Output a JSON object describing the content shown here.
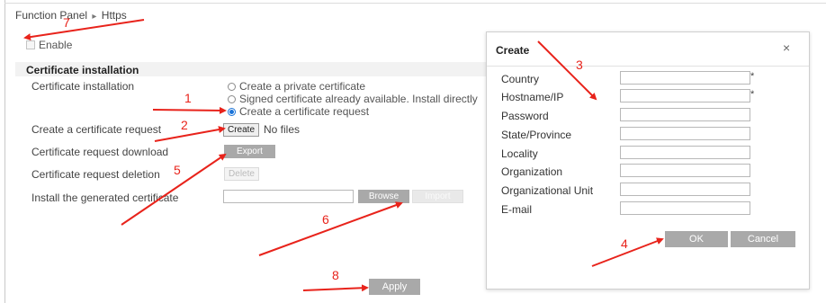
{
  "breadcrumb": {
    "root": "Function Panel",
    "separator": "▸",
    "current": "Https"
  },
  "enable": {
    "label": "Enable",
    "checked": false
  },
  "certificate": {
    "section_title": "Certificate installation",
    "installation_label": "Certificate installation",
    "options": [
      {
        "label": "Create a private certificate",
        "selected": false
      },
      {
        "label": "Signed certificate already available. Install directly",
        "selected": false
      },
      {
        "label": "Create a certificate request",
        "selected": true
      }
    ],
    "request_label": "Create a certificate request",
    "create_button": "Create",
    "no_files": "No files",
    "download_label": "Certificate request download",
    "export_button": "Export",
    "deletion_label": "Certificate request deletion",
    "delete_button": "Delete",
    "install_label": "Install the generated certificate",
    "install_value": "",
    "browse_button": "Browse",
    "import_button": "Import"
  },
  "apply_button": "Apply",
  "dialog": {
    "title": "Create",
    "close_symbol": "×",
    "fields": [
      {
        "label": "Country",
        "value": "",
        "required_mark": "*"
      },
      {
        "label": "Hostname/IP",
        "value": "",
        "required_mark": "*"
      },
      {
        "label": "Password",
        "value": "",
        "required_mark": ""
      },
      {
        "label": "State/Province",
        "value": "",
        "required_mark": ""
      },
      {
        "label": "Locality",
        "value": "",
        "required_mark": ""
      },
      {
        "label": "Organization",
        "value": "",
        "required_mark": ""
      },
      {
        "label": "Organizational Unit",
        "value": "",
        "required_mark": ""
      },
      {
        "label": "E-mail",
        "value": "",
        "required_mark": ""
      }
    ],
    "ok_button": "OK",
    "cancel_button": "Cancel"
  },
  "annotations": {
    "color": "#e8231b",
    "numbers": [
      "1",
      "2",
      "3",
      "4",
      "5",
      "6",
      "7",
      "8"
    ]
  },
  "colors": {
    "button_gray": "#a9a9a9",
    "radio_selected": "#1a73d9",
    "section_bar": "#f2f2f2"
  }
}
